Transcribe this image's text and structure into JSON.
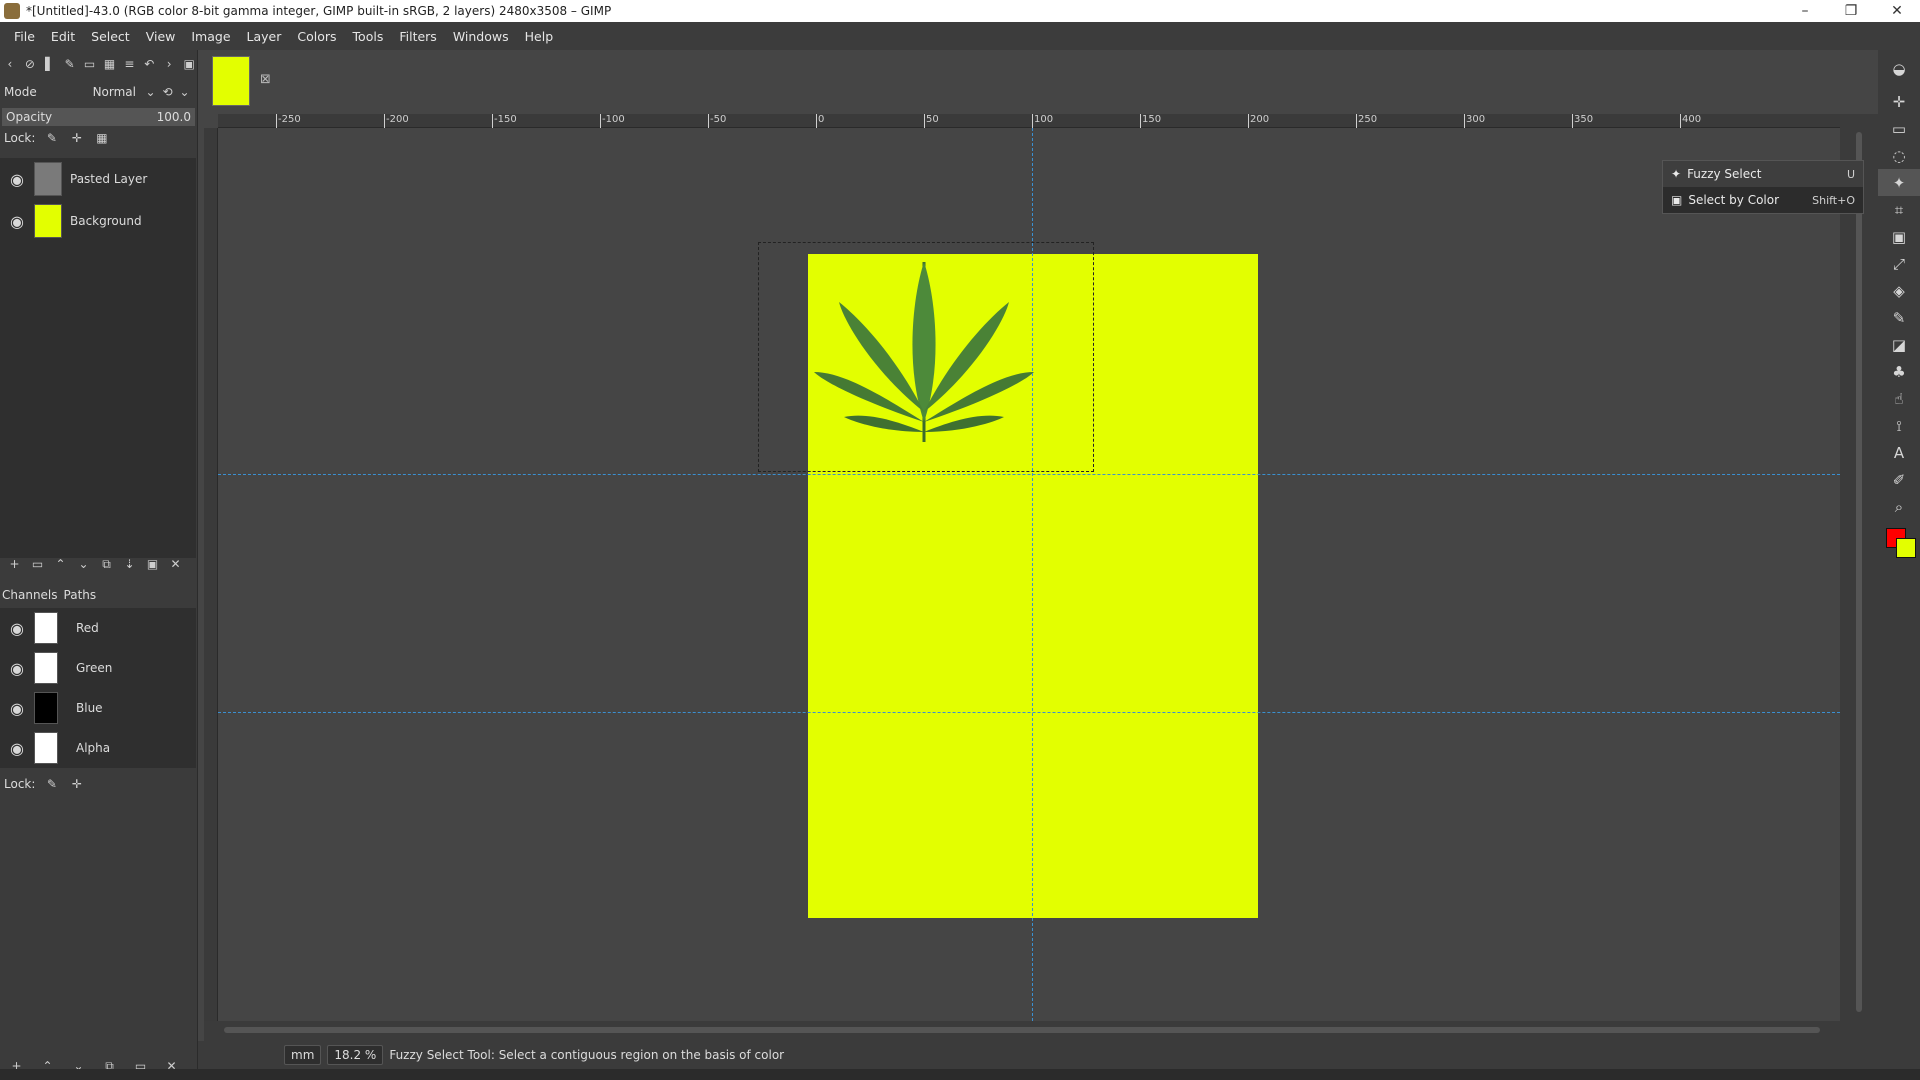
{
  "window": {
    "title": "*[Untitled]-43.0 (RGB color 8-bit gamma integer, GIMP built-in sRGB, 2 layers) 2480x3508 – GIMP",
    "minimize": "–",
    "maximize": "❐",
    "close": "✕"
  },
  "menu": [
    "File",
    "Edit",
    "Select",
    "View",
    "Image",
    "Layer",
    "Colors",
    "Tools",
    "Filters",
    "Windows",
    "Help"
  ],
  "layers_panel": {
    "mode_label": "Mode",
    "mode_value": "Normal",
    "opacity_label": "Opacity",
    "opacity_value": "100.0",
    "lock_label": "Lock:",
    "layers": [
      {
        "name": "Pasted Layer"
      },
      {
        "name": "Background"
      }
    ]
  },
  "channels_panel": {
    "tab_channels": "Channels",
    "tab_paths": "Paths",
    "channels": [
      {
        "name": "Red"
      },
      {
        "name": "Green"
      },
      {
        "name": "Blue"
      },
      {
        "name": "Alpha"
      }
    ],
    "lock_label": "Lock:"
  },
  "ruler": {
    "labels": [
      "-250",
      "-200",
      "-150",
      "-100",
      "-50",
      "0",
      "50",
      "100",
      "150",
      "200",
      "250",
      "300",
      "350",
      "400"
    ]
  },
  "statusbar": {
    "unit": "mm",
    "zoom": "18.2 %",
    "message": "Fuzzy Select Tool: Select a contiguous region on the basis of color"
  },
  "tool_popup": {
    "items": [
      {
        "label": "Fuzzy Select",
        "shortcut": "U"
      },
      {
        "label": "Select by Color",
        "shortcut": "Shift+O"
      }
    ]
  },
  "colors": {
    "foreground": "#ff0000",
    "background": "#e3ff00",
    "canvas_fill": "#e3ff00",
    "guide": "#3b8fd0"
  }
}
